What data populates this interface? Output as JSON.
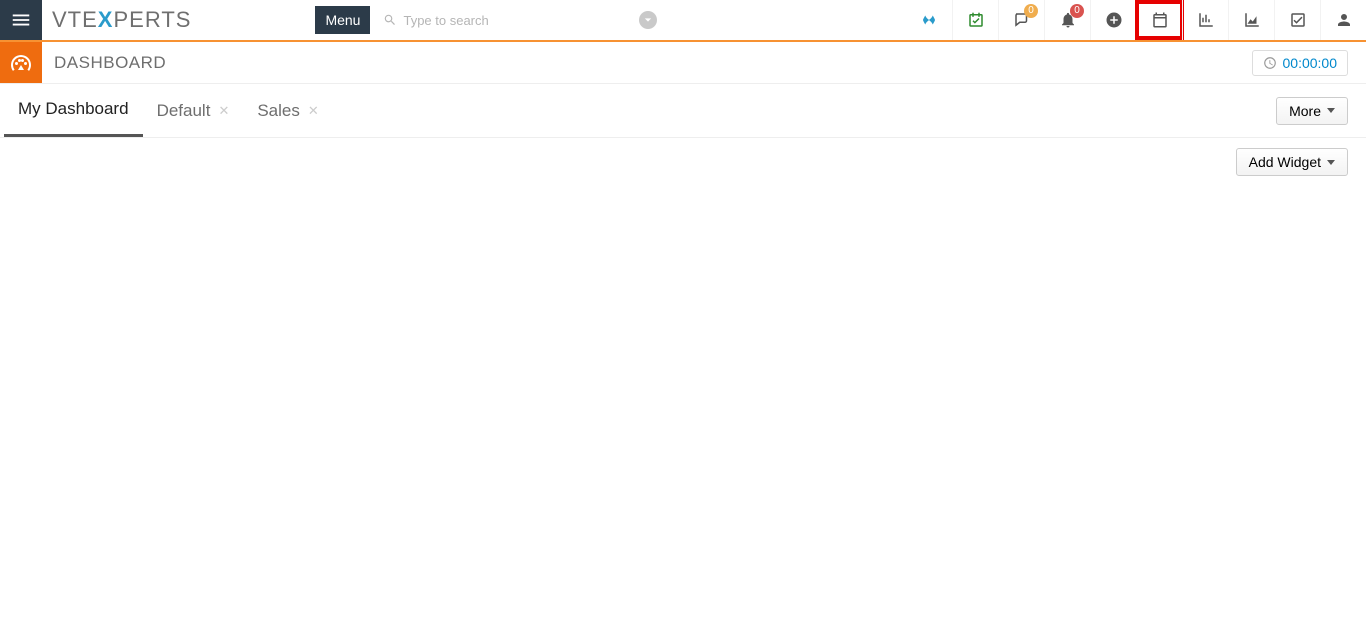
{
  "header": {
    "logo_left": "VTE",
    "logo_x": "X",
    "logo_right": "PERTS",
    "menu_label": "Menu",
    "search_placeholder": "Type to search",
    "chat_badge": "0",
    "bell_badge": "0"
  },
  "module": {
    "title": "DASHBOARD",
    "timer": "00:00:00"
  },
  "tabs": [
    {
      "label": "My Dashboard",
      "closable": false,
      "active": true
    },
    {
      "label": "Default",
      "closable": true,
      "active": false
    },
    {
      "label": "Sales",
      "closable": true,
      "active": false
    }
  ],
  "more_label": "More",
  "add_widget_label": "Add Widget"
}
